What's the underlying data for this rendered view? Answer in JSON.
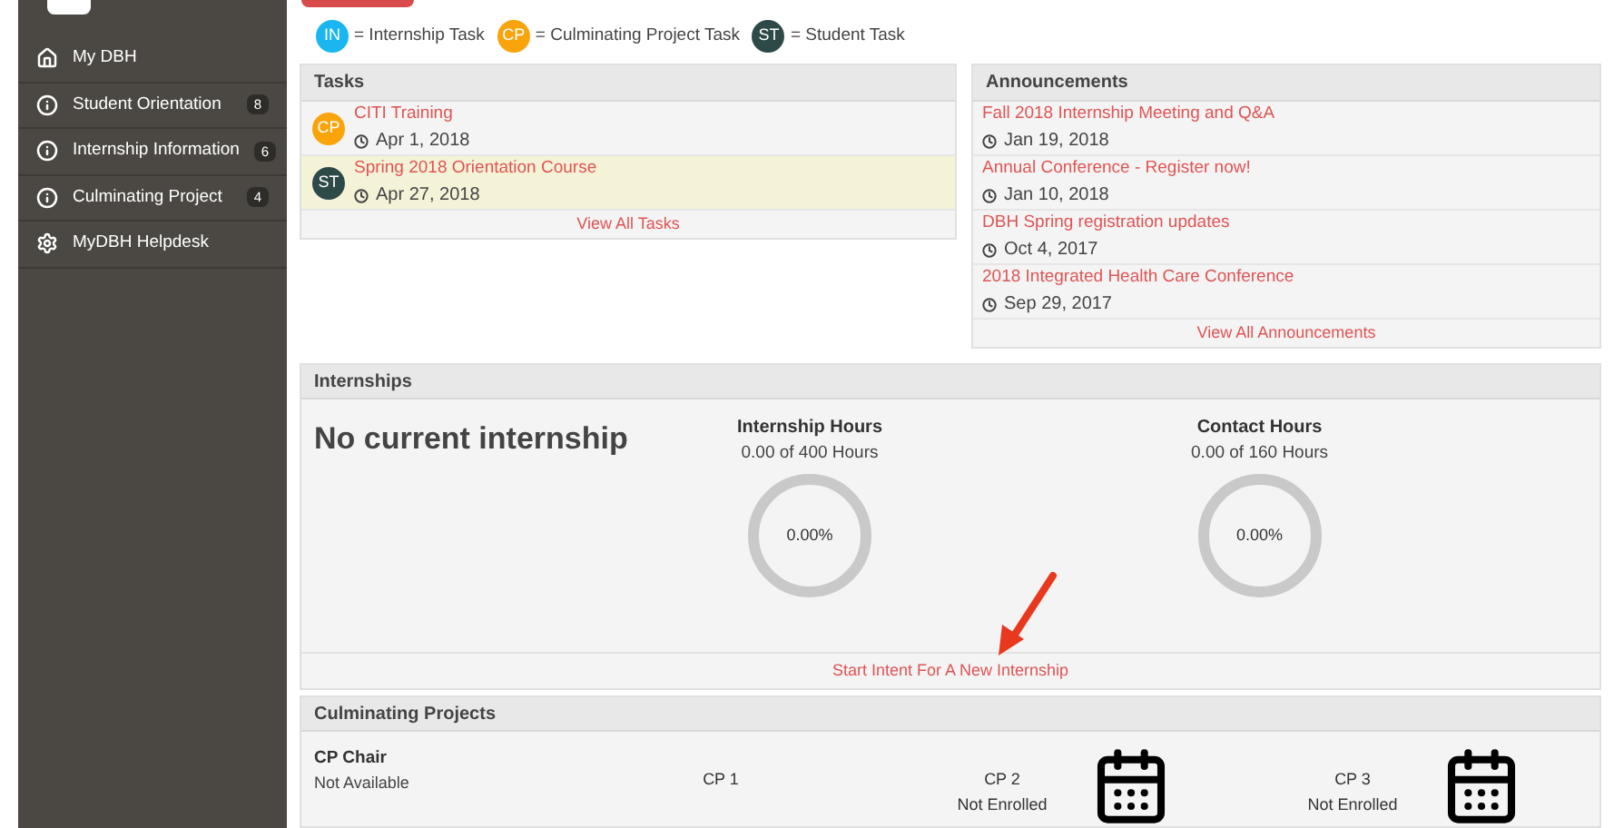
{
  "sidebar": {
    "items": [
      {
        "label": "My DBH",
        "kind": "home"
      },
      {
        "label": "Student Orientation",
        "kind": "info",
        "count": "8"
      },
      {
        "label": "Internship Information",
        "kind": "info",
        "count": "6"
      },
      {
        "label": "Culminating Project",
        "kind": "info",
        "count": "4"
      },
      {
        "label": "MyDBH Helpdesk",
        "kind": "settings"
      }
    ]
  },
  "legend": [
    {
      "badge": "IN",
      "label": "= Internship Task",
      "color": "#1ab6ef"
    },
    {
      "badge": "CP",
      "label": "= Culminating Project Task",
      "color": "#f9a40b"
    },
    {
      "badge": "ST",
      "label": "= Student Task",
      "color": "#2d4a48"
    }
  ],
  "tasks": {
    "title": "Tasks",
    "items": [
      {
        "badge": "CP",
        "color": "#f9a40b",
        "title": "CITI Training",
        "date": "Apr 1, 2018",
        "highlighted": false
      },
      {
        "badge": "ST",
        "color": "#2d4a48",
        "title": "Spring 2018 Orientation Course",
        "date": "Apr 27, 2018",
        "highlighted": true
      }
    ],
    "footer": "View All Tasks"
  },
  "announcements": {
    "title": "Announcements",
    "items": [
      {
        "title": "Fall 2018 Internship Meeting and Q&A",
        "date": "Jan 19, 2018"
      },
      {
        "title": "Annual Conference - Register now!",
        "date": "Jan 10, 2018"
      },
      {
        "title": "DBH Spring registration updates",
        "date": "Oct 4, 2017"
      },
      {
        "title": "2018 Integrated Health Care Conference",
        "date": "Sep 29, 2017"
      }
    ],
    "footer": "View All Announcements"
  },
  "internships": {
    "title": "Internships",
    "status": "No current internship",
    "meters": [
      {
        "title": "Internship Hours",
        "subtitle": "0.00 of 400 Hours",
        "reading": "0.00%"
      },
      {
        "title": "Contact Hours",
        "subtitle": "0.00 of 160 Hours",
        "reading": "0.00%"
      }
    ],
    "footer": "Start Intent For A New Internship"
  },
  "culminating_projects": {
    "title": "Culminating Projects",
    "items": [
      {
        "title": "CP Chair",
        "status": "Not Available",
        "kind": "chair"
      },
      {
        "title": "CP 1",
        "kind": "plain"
      },
      {
        "title": "CP 2",
        "status": "Not Enrolled",
        "kind": "calendar"
      },
      {
        "title": "CP 3",
        "status": "Not Enrolled",
        "kind": "calendar"
      }
    ]
  }
}
